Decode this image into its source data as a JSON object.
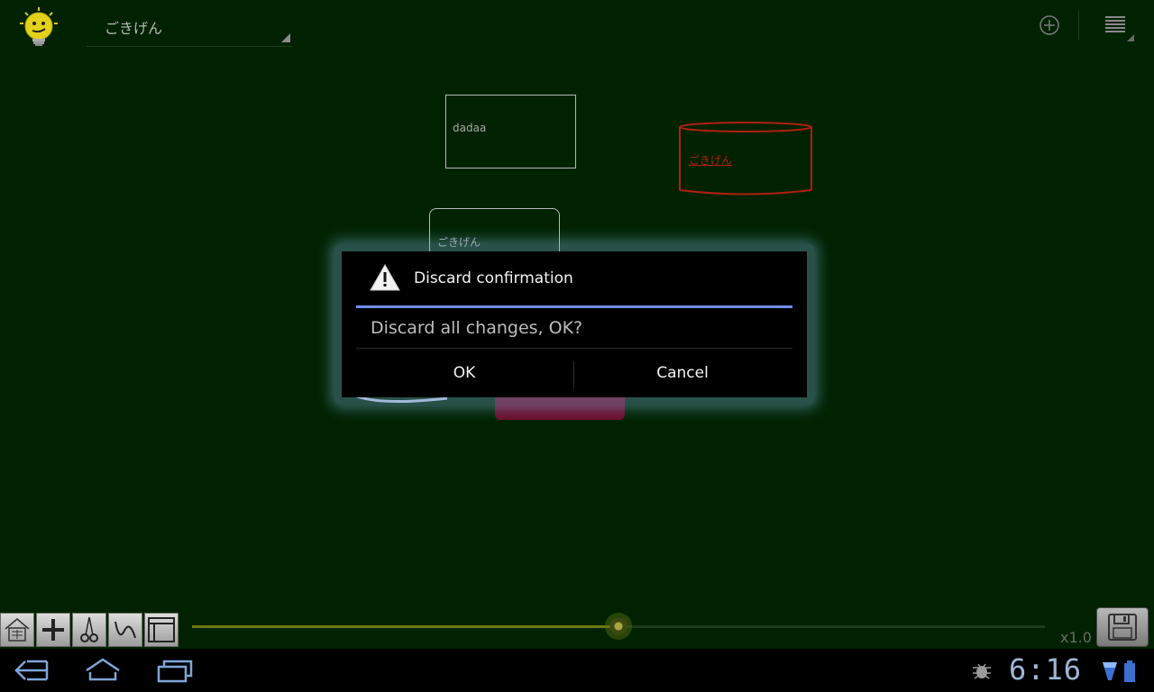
{
  "action_bar": {
    "document_name": "ごきげん"
  },
  "nodes": [
    {
      "label": "dadaa"
    },
    {
      "label": "ごきげん"
    },
    {
      "label": "ごきげん"
    }
  ],
  "zoom": {
    "label": "x1.0",
    "slider_fraction": 0.5
  },
  "dialog": {
    "title": "Discard confirmation",
    "message": "Discard all changes, OK?",
    "ok_label": "OK",
    "cancel_label": "Cancel"
  },
  "status_bar": {
    "time": "6:16"
  },
  "colors": {
    "canvas_bg": "#002200",
    "accent_rule": "#6f8ff0",
    "cylinder_node": "#b02010"
  }
}
